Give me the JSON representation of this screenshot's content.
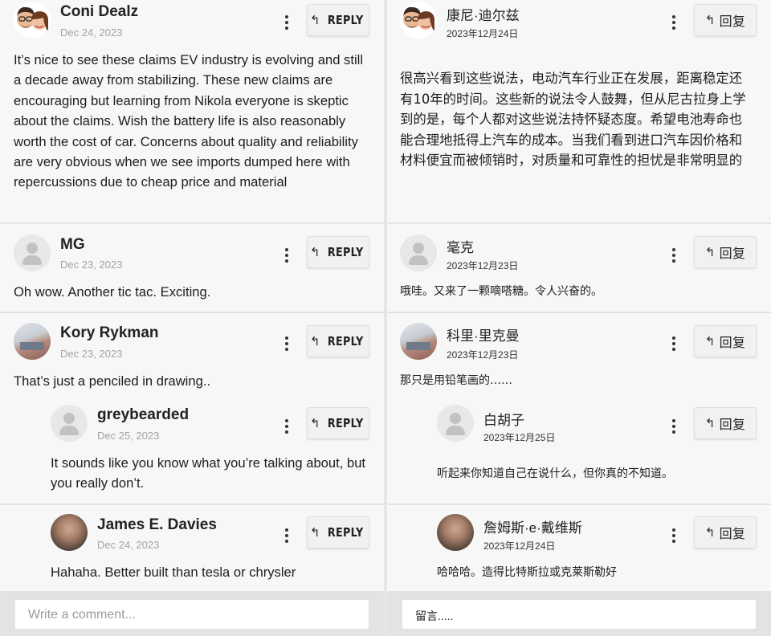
{
  "english": {
    "comments": [
      {
        "author": "Coni Dealz",
        "date": "Dec 24, 2023",
        "avatar": "memoji-couple-icon",
        "text": "It’s nice to see these claims EV industry is evolving and still a decade away from stabilizing. These new claims are encouraging but learning from Nikola everyone is skeptic about the claims. Wish the battery life is also reasonably worth the cost of car. Concerns about quality and reliability are very obvious when we see imports dumped here with repercussions due to cheap price and material",
        "reply_label": "REPLY"
      },
      {
        "author": "MG",
        "date": "Dec 23, 2023",
        "avatar": "default-user-icon",
        "text": "Oh wow. Another tic tac. Exciting.",
        "reply_label": "REPLY"
      },
      {
        "author": "Kory Rykman",
        "date": "Dec 23, 2023",
        "avatar": "photo-avatar",
        "text": "That’s just a penciled in drawing..",
        "reply_label": "REPLY"
      },
      {
        "author": "greybearded",
        "date": "Dec 25, 2023",
        "avatar": "default-user-icon",
        "text": "It sounds like you know what you’re talking about, but you really don’t.",
        "reply_label": "REPLY"
      },
      {
        "author": "James E. Davies",
        "date": "Dec 24, 2023",
        "avatar": "photo-avatar",
        "text": "Hahaha. Better built than tesla or chrysler",
        "reply_label": "REPLY"
      }
    ],
    "input_placeholder": "Write a comment..."
  },
  "chinese": {
    "comments": [
      {
        "author": "康尼·迪尔兹",
        "date": "2023年12月24日",
        "avatar": "memoji-couple-icon",
        "text": "很高兴看到这些说法，电动汽车行业正在发展，距离稳定还有10年的时间。这些新的说法令人鼓舞，但从尼古拉身上学到的是，每个人都对这些说法持怀疑态度。希望电池寿命也能合理地抵得上汽车的成本。当我们看到进口汽车因价格和材料便宜而被倾销时，对质量和可靠性的担忧是非常明显的",
        "reply_label": "回复"
      },
      {
        "author": "毫克",
        "date": "2023年12月23日",
        "avatar": "default-user-icon",
        "text": "哦哇。又来了一颗嘀嗒糖。令人兴奋的。",
        "reply_label": "回复"
      },
      {
        "author": "科里·里克曼",
        "date": "2023年12月23日",
        "avatar": "photo-avatar",
        "text": "那只是用铅笔画的……",
        "reply_label": "回复"
      },
      {
        "author": "白胡子",
        "date": "2023年12月25日",
        "avatar": "default-user-icon",
        "text": "听起来你知道自己在说什么，但你真的不知道。",
        "reply_label": "回复"
      },
      {
        "author": "詹姆斯·e·戴维斯",
        "date": "2023年12月24日",
        "avatar": "photo-avatar",
        "text": "哈哈哈。造得比特斯拉或克莱斯勒好",
        "reply_label": "回复"
      }
    ],
    "input_placeholder": "留言....."
  }
}
